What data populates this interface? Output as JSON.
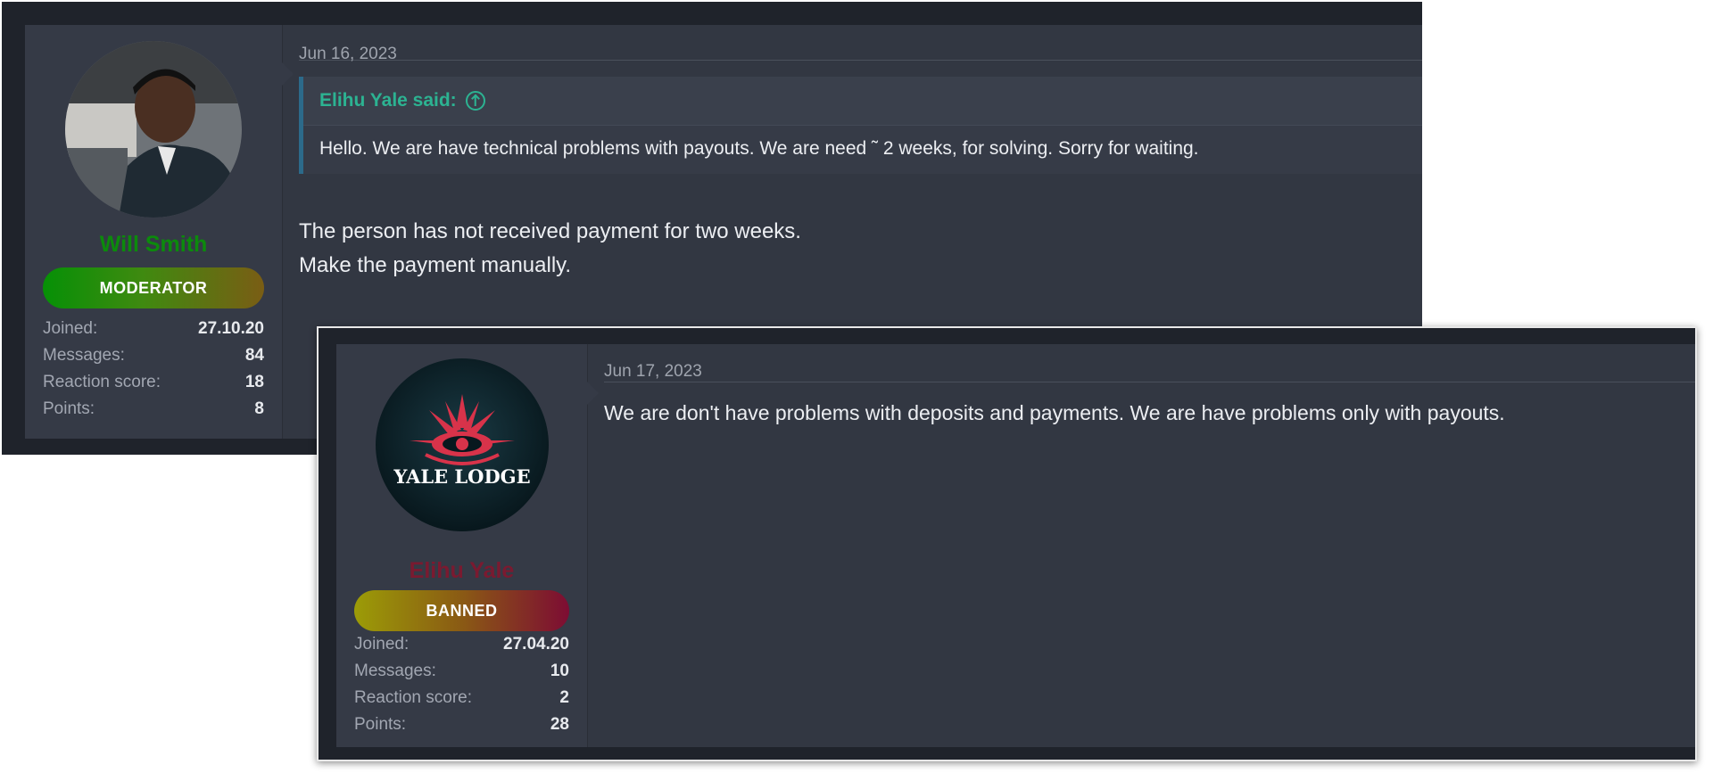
{
  "posts": [
    {
      "date": "Jun 16, 2023",
      "user": {
        "name": "Will Smith",
        "role": "MODERATOR",
        "avatar": "user-photo-avatar",
        "stats": [
          {
            "label": "Joined:",
            "value": "27.10.20"
          },
          {
            "label": "Messages:",
            "value": "84"
          },
          {
            "label": "Reaction score:",
            "value": "18"
          },
          {
            "label": "Points:",
            "value": "8"
          }
        ]
      },
      "quote": {
        "author": "Elihu Yale said:",
        "icon": "arrow-up-circle-icon",
        "text": "Hello. We are have technical problems with payouts. We are need ˜ 2 weeks, for solving. Sorry for waiting."
      },
      "body": [
        "The person has not received payment for two weeks.",
        "Make the payment manually."
      ]
    },
    {
      "date": "Jun 17, 2023",
      "user": {
        "name": "Elihu Yale",
        "role": "BANNED",
        "avatar": "yale-lodge-logo-avatar",
        "avatar_text": "YALE LODGE",
        "stats": [
          {
            "label": "Joined:",
            "value": "27.04.20"
          },
          {
            "label": "Messages:",
            "value": "10"
          },
          {
            "label": "Reaction score:",
            "value": "2"
          },
          {
            "label": "Points:",
            "value": "28"
          }
        ]
      },
      "body": [
        "We are don't have problems with deposits and payments. We are have problems only with payouts."
      ]
    }
  ],
  "colors": {
    "moderator_name": "#0c8a0c",
    "banned_name": "#7a1a30",
    "quote_accent": "#2cb392",
    "panel_bg": "#323742"
  }
}
